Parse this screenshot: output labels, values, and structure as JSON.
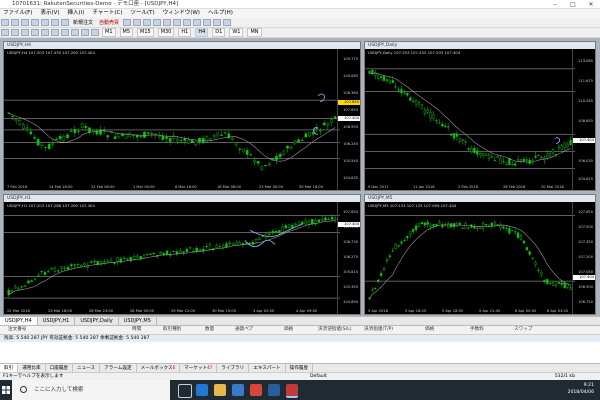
{
  "window": {
    "title": "10701631: RakutenSecurities-Demo - デモ口座 - [USDJPY,H4]"
  },
  "menu": [
    "ファイル(F)",
    "表示(V)",
    "挿入(I)",
    "チャート(C)",
    "ツール(T)",
    "ウィンドウ(W)",
    "ヘルプ(H)"
  ],
  "toolbar": {
    "new_order": "新規注文",
    "auto_trade": "自動売買",
    "timeframes": [
      "M1",
      "M5",
      "M15",
      "M30",
      "H1",
      "H4",
      "D1",
      "W1",
      "MN"
    ]
  },
  "charts": {
    "h4": {
      "title": "USDJPY,H4",
      "info": "USDJPY,H4  107.203 107.435 107.200 107.404",
      "prices": [
        "109.770",
        "109.065",
        "108.360",
        "107.655",
        "106.950",
        "106.245",
        "105.540",
        "104.835"
      ],
      "current": "107.404",
      "line_b": "107.655",
      "xlabels": [
        "7 Feb 2018",
        "14 Feb 16:00",
        "22 Feb 08:00",
        "1 Mar 00:00",
        "8 Mar 16:00",
        "16 Mar 08:00",
        "23 Mar 00:00",
        "30 Mar 16:00"
      ]
    },
    "daily": {
      "title": "USDJPY,Daily",
      "info": "USDJPY,Daily  107.203 107.435 107.203 107.404",
      "prices": [
        "113.085",
        "111.675",
        "110.265",
        "108.855",
        "107.445",
        "106.035",
        "104.625"
      ],
      "current": "107.404",
      "xlabels": [
        "9 Dec 2017",
        "11 Jan 2018",
        "2 Feb 2018",
        "26 Feb 2018",
        "20 Mar 2018"
      ]
    },
    "h1": {
      "title": "USDJPY,H1",
      "info": "USDJPY,H1  107.203 107.268 107.200 107.404",
      "prices": [
        "107.650",
        "107.190",
        "106.730",
        "106.270",
        "105.810",
        "105.350",
        "104.890"
      ],
      "current": "107.404",
      "xlabels": [
        "22 Mar 2018",
        "23 Mar 16:00",
        "26 Mar 23:00",
        "28 Mar 05:00",
        "29 Mar 12:00",
        "30 Mar 19:00",
        "3 Apr 02:00",
        "4 Apr 09:00"
      ]
    },
    "m5": {
      "title": "USDJPY,M5",
      "info": "USDJPY,M5  107.133 107.133 107.099 107.404",
      "prices": [
        "107.650",
        "107.500",
        "107.350",
        "107.200",
        "107.050",
        "106.900",
        "106.750"
      ],
      "current": "107.404",
      "xlabels": [
        "5 Apr 2018",
        "5 Apr 16:25",
        "5 Apr 18:55",
        "5 Apr 21:45",
        "6 Apr 00:45",
        "6 Apr 03:20"
      ]
    }
  },
  "chart_tabs": [
    "USDJPY,H4",
    "USDJPY,H1",
    "USDJPY,Daily",
    "USDJPY,M5"
  ],
  "terminal": {
    "columns": [
      "注文番号",
      "時間",
      "取引種別",
      "数量",
      "通貨ペア",
      "価格",
      "決済逆指値(S/L)",
      "決済指値(T/P)",
      "価格",
      "手数料",
      "スワップ"
    ],
    "balance_row": "残高: 5 540 287 JPY  有効証拠金: 5 540 287  余剰証拠金: 5 540 287"
  },
  "terminal_tabs": [
    {
      "label": "取引",
      "badge": ""
    },
    {
      "label": "運用比率",
      "badge": ""
    },
    {
      "label": "口座履歴",
      "badge": ""
    },
    {
      "label": "ニュース",
      "badge": ""
    },
    {
      "label": "アラーム設定",
      "badge": ""
    },
    {
      "label": "メールボックス",
      "badge": "6"
    },
    {
      "label": "マーケット",
      "badge": "47"
    },
    {
      "label": "ライブラリ",
      "badge": ""
    },
    {
      "label": "エキスパート",
      "badge": ""
    },
    {
      "label": "操作履歴",
      "badge": ""
    }
  ],
  "status": {
    "help": "F1キーでヘルプを表示します",
    "profile": "Default",
    "traffic": "532/1 kb"
  },
  "taskbar": {
    "search_placeholder": "ここに入力して検索",
    "time": "9:21",
    "date": "2018/04/06"
  },
  "colors": {
    "candle_up": "#00dd00",
    "candle_down": "#00aa00",
    "ma_line": "#9a9a9a",
    "annotation": "#8fb8ff",
    "tag": "#ffd700"
  }
}
